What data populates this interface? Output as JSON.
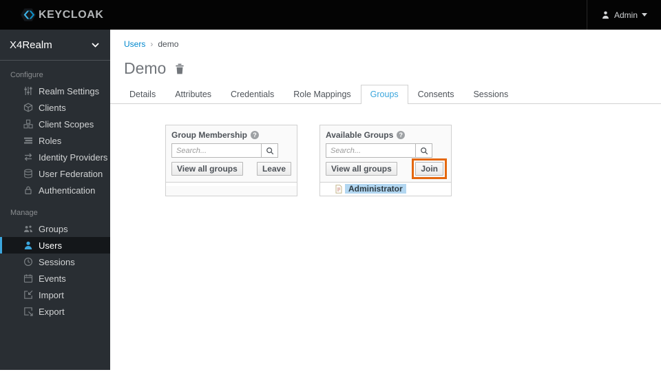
{
  "topbar": {
    "brand": "KEYCLOAK",
    "user_label": "Admin"
  },
  "sidebar": {
    "realm_name": "X4Realm",
    "sections": [
      {
        "label": "Configure",
        "items": [
          {
            "label": "Realm Settings"
          },
          {
            "label": "Clients"
          },
          {
            "label": "Client Scopes"
          },
          {
            "label": "Roles"
          },
          {
            "label": "Identity Providers"
          },
          {
            "label": "User Federation"
          },
          {
            "label": "Authentication"
          }
        ]
      },
      {
        "label": "Manage",
        "items": [
          {
            "label": "Groups"
          },
          {
            "label": "Users",
            "active": true
          },
          {
            "label": "Sessions"
          },
          {
            "label": "Events"
          },
          {
            "label": "Import"
          },
          {
            "label": "Export"
          }
        ]
      }
    ]
  },
  "breadcrumb": {
    "link": "Users",
    "separator": "›",
    "current": "demo"
  },
  "page": {
    "title": "Demo"
  },
  "tabs": [
    {
      "label": "Details"
    },
    {
      "label": "Attributes"
    },
    {
      "label": "Credentials"
    },
    {
      "label": "Role Mappings"
    },
    {
      "label": "Groups",
      "active": true
    },
    {
      "label": "Consents"
    },
    {
      "label": "Sessions"
    }
  ],
  "panels": {
    "membership": {
      "title": "Group Membership",
      "help": "?",
      "search_placeholder": "Search...",
      "view_all_label": "View all groups",
      "action_label": "Leave",
      "items": []
    },
    "available": {
      "title": "Available Groups",
      "help": "?",
      "search_placeholder": "Search...",
      "view_all_label": "View all groups",
      "action_label": "Join",
      "items": [
        {
          "label": "Administrator",
          "selected": true
        }
      ]
    }
  },
  "colors": {
    "accent_blue": "#39a5dc",
    "highlight_orange": "#e4680f",
    "selection_blue": "#b3d7f1",
    "sidebar_bg": "#292e33",
    "topbar_bg": "#040404"
  }
}
